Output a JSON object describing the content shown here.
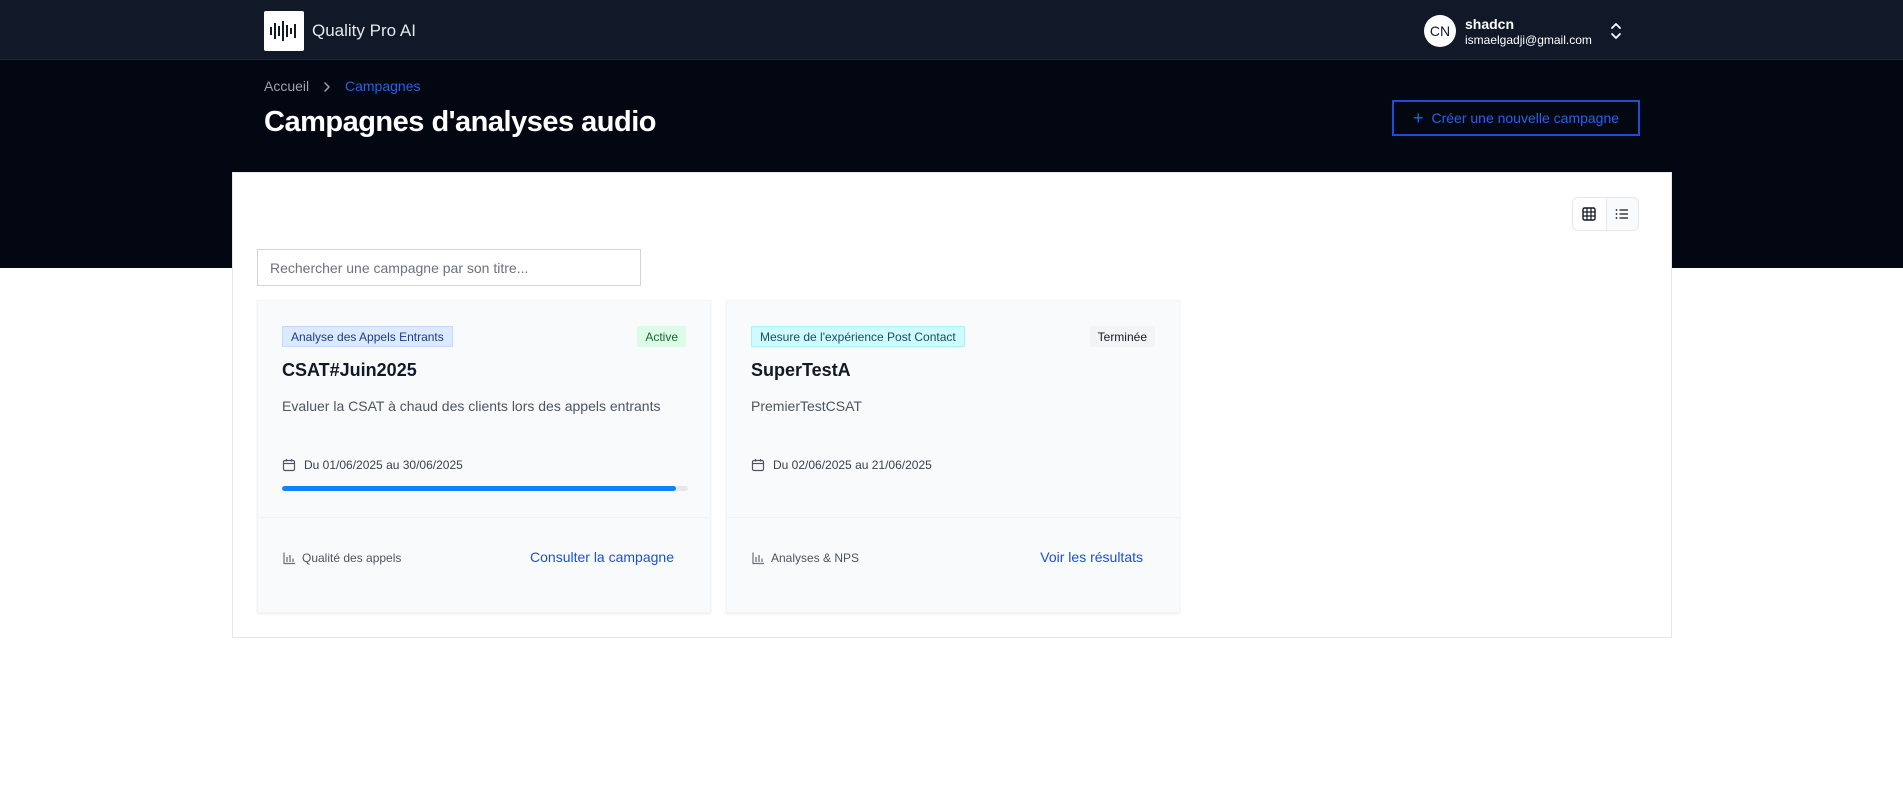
{
  "app": {
    "title": "Quality Pro AI",
    "logo_icon": "audio-waveform-icon"
  },
  "user": {
    "initials": "CN",
    "name": "shadcn",
    "email": "ismaelgadji@gmail.com"
  },
  "breadcrumb": {
    "home": "Accueil",
    "current": "Campagnes"
  },
  "page": {
    "title": "Campagnes d'analyses audio",
    "create_label": "Créer une nouvelle campagne"
  },
  "search": {
    "placeholder": "Rechercher une campagne par son titre...",
    "value": ""
  },
  "view_toggle": {
    "options": [
      "grid",
      "list"
    ],
    "selected": "grid"
  },
  "campaigns": [
    {
      "tag": "Analyse des Appels Entrants",
      "status": "Active",
      "title": "CSAT#Juin2025",
      "description": "Evaluer la CSAT à chaud des clients lors des appels entrants",
      "dates": "Du 01/06/2025 au 30/06/2025",
      "progress_percent": 97,
      "category": "Qualité des appels",
      "action": "Consulter la campagne"
    },
    {
      "tag": "Mesure de l'expérience Post Contact",
      "status": "Terminée",
      "title": "SuperTestA",
      "description": "PremierTestCSAT",
      "dates": "Du 02/06/2025 au 21/06/2025",
      "category": "Analyses & NPS",
      "action": "Voir les résultats"
    }
  ],
  "colors": {
    "accent": "#2563eb",
    "header_bg": "#111827",
    "hero_bg": "#030712",
    "progress": "#0a84ff",
    "status_active": "#166534"
  }
}
